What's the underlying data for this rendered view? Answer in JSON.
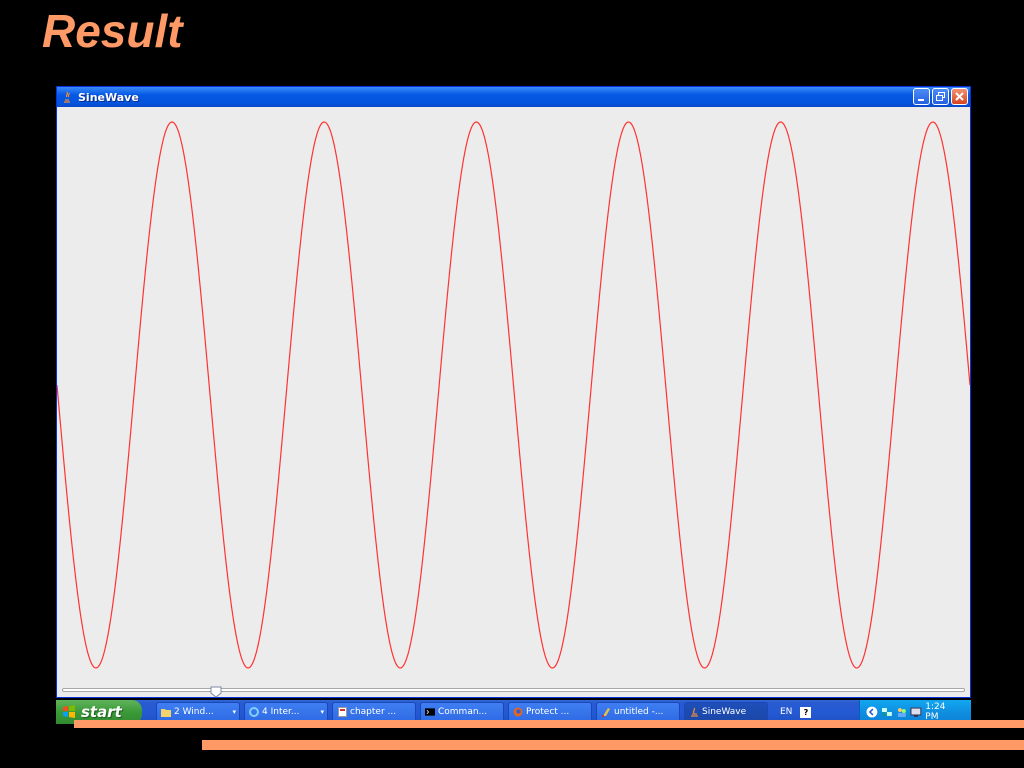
{
  "slide": {
    "title": "Result"
  },
  "window": {
    "title": "SineWave"
  },
  "plot": {
    "line_color": "#ff3333",
    "cycles": 6,
    "slider_value_fraction": 0.17
  },
  "taskbar": {
    "start_label": "start",
    "buttons": [
      {
        "label": "2 Wind...",
        "icon": "folder-icon",
        "dropdown": true
      },
      {
        "label": "4 Inter...",
        "icon": "internet-explorer-icon",
        "dropdown": true
      },
      {
        "label": "chapter ...",
        "icon": "document-icon",
        "dropdown": false
      },
      {
        "label": "Comman...",
        "icon": "command-prompt-icon",
        "dropdown": false
      },
      {
        "label": "Protect ...",
        "icon": "firefox-icon",
        "dropdown": false
      },
      {
        "label": "untitled -...",
        "icon": "paint-icon",
        "dropdown": false
      },
      {
        "label": "SineWave",
        "icon": "java-icon",
        "dropdown": false
      }
    ],
    "language": "EN",
    "clock": "1:24 PM"
  },
  "colors": {
    "accent": "#ff9966",
    "title_bar": "#0558e3",
    "taskbar": "#245ad4",
    "start_button": "#3c9a3a",
    "tray": "#0f8fe0"
  }
}
